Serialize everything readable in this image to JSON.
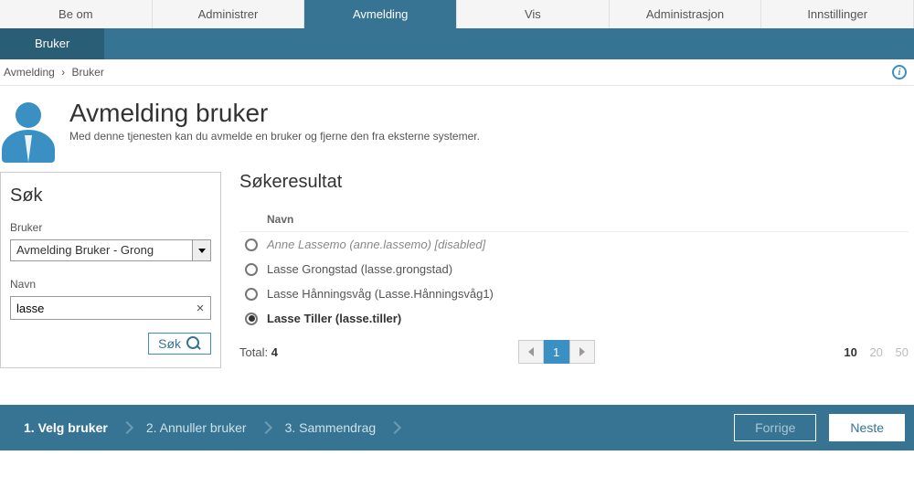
{
  "top_nav": {
    "items": [
      "Be om",
      "Administrer",
      "Avmelding",
      "Vis",
      "Administrasjon",
      "Innstillinger"
    ],
    "active_index": 2
  },
  "sub_nav": {
    "items": [
      "Bruker"
    ],
    "active_index": 0
  },
  "breadcrumb": {
    "root": "Avmelding",
    "current": "Bruker"
  },
  "page": {
    "title": "Avmelding bruker",
    "subtitle": "Med denne tjenesten kan du avmelde en bruker og fjerne den fra eksterne systemer."
  },
  "search": {
    "heading": "Søk",
    "user_label": "Bruker",
    "user_selected": "Avmelding Bruker - Grong",
    "name_label": "Navn",
    "name_value": "lasse",
    "clear_glyph": "×",
    "button_label": "Søk"
  },
  "results": {
    "heading": "Søkeresultat",
    "column_header": "Navn",
    "rows": [
      {
        "label": "Anne Lassemo (anne.lassemo) [disabled]",
        "disabled": true,
        "selected": false
      },
      {
        "label": "Lasse Grongstad (lasse.grongstad)",
        "disabled": false,
        "selected": false
      },
      {
        "label": "Lasse Hånningsvåg (Lasse.Hånningsvåg1)",
        "disabled": false,
        "selected": false
      },
      {
        "label": "Lasse Tiller (lasse.tiller)",
        "disabled": false,
        "selected": true
      }
    ],
    "total_label": "Total:",
    "total_value": "4",
    "current_page": "1",
    "page_sizes": [
      "10",
      "20",
      "50"
    ],
    "active_page_size": 0
  },
  "wizard": {
    "steps": [
      "1. Velg bruker",
      "2. Annuller bruker",
      "3. Sammendrag"
    ],
    "active_index": 0,
    "prev_label": "Forrige",
    "next_label": "Neste"
  },
  "icons": {
    "info": "i"
  }
}
